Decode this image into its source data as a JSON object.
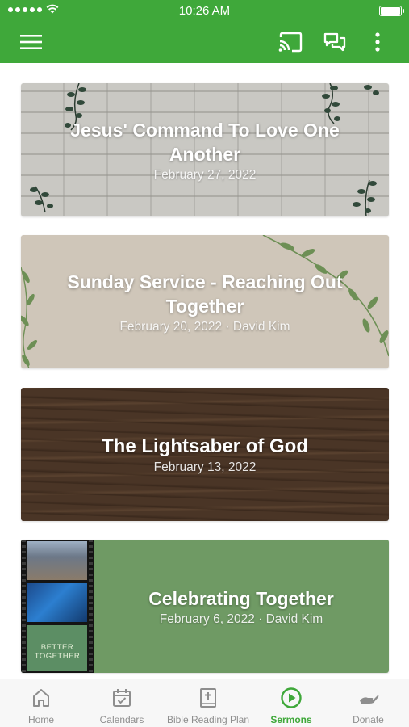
{
  "status_bar": {
    "time": "10:26 AM"
  },
  "app_bar": {
    "icons": [
      "menu-icon",
      "cast-icon",
      "chat-icon",
      "more-vertical-icon"
    ]
  },
  "sermons": [
    {
      "title": "Jesus' Command To Love One Another",
      "subtitle": "February 27, 2022"
    },
    {
      "title": "Sunday Service - Reaching Out Together",
      "subtitle": "February 20, 2022 · David Kim"
    },
    {
      "title": "The Lightsaber of God",
      "subtitle": "February 13, 2022"
    },
    {
      "title": "Celebrating Together",
      "subtitle": "February 6, 2022 · David Kim",
      "thumbnail_text": "BETTER TOGETHER"
    }
  ],
  "tab_bar": {
    "items": [
      {
        "label": "Home",
        "icon": "home-icon"
      },
      {
        "label": "Calendars",
        "icon": "calendar-icon"
      },
      {
        "label": "Bible Reading Plan",
        "icon": "bible-icon"
      },
      {
        "label": "Sermons",
        "icon": "play-circle-icon",
        "active": true
      },
      {
        "label": "Donate",
        "icon": "donate-hand-icon"
      }
    ]
  },
  "colors": {
    "brand_green": "#3fa83a",
    "tab_inactive": "#8e8e8e",
    "tab_bar_bg": "#f7f7f7"
  }
}
